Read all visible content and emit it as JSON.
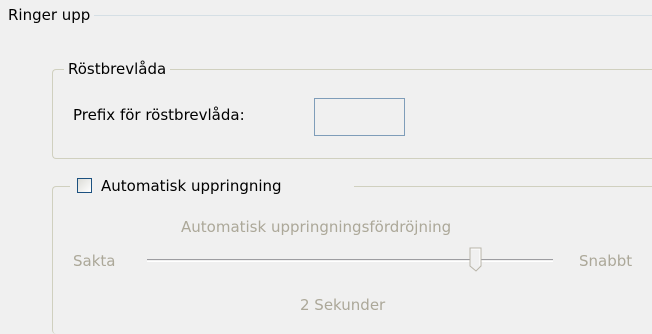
{
  "dialing": {
    "group_title": "Ringer upp",
    "voicemail": {
      "group_title": "Röstbrevlåda",
      "prefix_label": "Prefix för röstbrevlåda:",
      "prefix_value": ""
    },
    "auto_dial": {
      "checkbox_label": "Automatisk uppringning",
      "checked": false,
      "delay_title": "Automatisk uppringningsfördröjning",
      "slow_label": "Sakta",
      "fast_label": "Snabbt",
      "delay_value_label": "2 Sekunder",
      "slider_position": 0.81
    }
  }
}
